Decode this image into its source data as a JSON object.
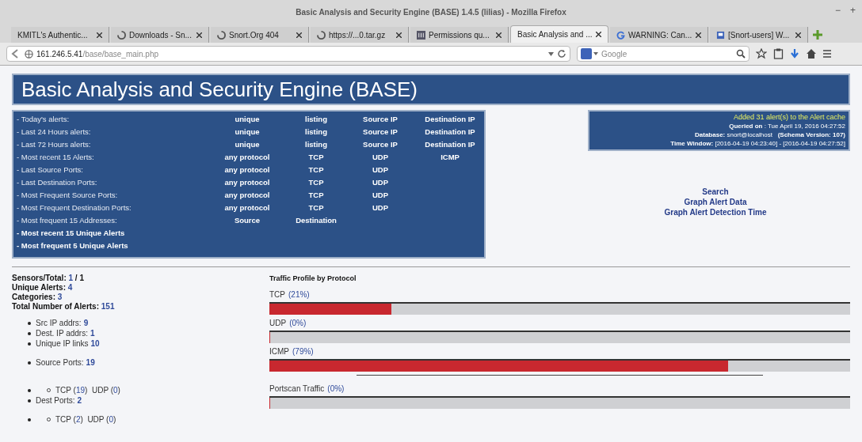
{
  "window": {
    "title": "Basic Analysis and Security Engine (BASE) 1.4.5 (lilias) - Mozilla Firefox",
    "controls": [
      "−",
      "+"
    ]
  },
  "tabs": [
    {
      "label": "KMITL's Authentic...",
      "kind": "plain",
      "selected": false
    },
    {
      "label": "Downloads - Sn...",
      "kind": "spinner",
      "selected": false
    },
    {
      "label": "Snort.Org 404",
      "kind": "spinner",
      "selected": false
    },
    {
      "label": "https://...0.tar.gz",
      "kind": "spinner",
      "selected": false
    },
    {
      "label": "Permissions qu...",
      "kind": "site",
      "selected": false
    },
    {
      "label": "Basic Analysis and ...",
      "kind": "plain",
      "selected": true
    },
    {
      "label": "WARNING: Can...",
      "kind": "google",
      "selected": false
    },
    {
      "label": "[Snort-users] W...",
      "kind": "page",
      "selected": false
    }
  ],
  "address_bar": {
    "host": "161.246.5.41",
    "path": "/base/base_main.php"
  },
  "search": {
    "placeholder": "Google"
  },
  "page": {
    "banner": "Basic Analysis and Security Engine (BASE)",
    "nav_rows": [
      {
        "label": "- Today's alerts:",
        "kind": "normal",
        "links": [
          "unique",
          "listing",
          "Source IP",
          "Destination IP"
        ]
      },
      {
        "label": "- Last 24 Hours alerts:",
        "kind": "normal",
        "links": [
          "unique",
          "listing",
          "Source IP",
          "Destination IP"
        ]
      },
      {
        "label": "- Last 72 Hours alerts:",
        "kind": "normal",
        "links": [
          "unique",
          "listing",
          "Source IP",
          "Destination IP"
        ]
      },
      {
        "label": "- Most recent 15 Alerts:",
        "kind": "normal",
        "links": [
          "any protocol",
          "TCP",
          "UDP",
          "ICMP"
        ]
      },
      {
        "label": "- Last Source Ports:",
        "kind": "normal",
        "links": [
          "any protocol",
          "TCP",
          "UDP"
        ]
      },
      {
        "label": "- Last Destination Ports:",
        "kind": "normal",
        "links": [
          "any protocol",
          "TCP",
          "UDP"
        ]
      },
      {
        "label": "- Most Frequent Source Ports:",
        "kind": "normal",
        "links": [
          "any protocol",
          "TCP",
          "UDP"
        ]
      },
      {
        "label": "- Most Frequent Destination Ports:",
        "kind": "normal",
        "links": [
          "any protocol",
          "TCP",
          "UDP"
        ]
      },
      {
        "label": "- Most frequent 15 Addresses:",
        "kind": "normal",
        "links": [
          "Source",
          "Destination"
        ]
      },
      {
        "label": "- Most recent 15 Unique Alerts",
        "kind": "link",
        "links": []
      },
      {
        "label": "- Most frequent 5 Unique Alerts",
        "kind": "link",
        "links": []
      }
    ],
    "info": {
      "notice": "Added 31 alert(s) to the Alert cache",
      "lines": [
        "**Queried on** : Tue April 19, 2016 04:27:52",
        "**Database:** snort@localhost   **(Schema Version: 107)**",
        "**Time Window:** [2016-04-19 04:23:40] - [2016-04-19 04:27:52]"
      ]
    },
    "actions": [
      "Search",
      "Graph Alert Data",
      "Graph Alert Detection Time"
    ],
    "stats": [
      {
        "label": "Sensors/Total:",
        "value": "1",
        "suffix": " / 1"
      },
      {
        "label": "Unique Alerts:",
        "value": "4"
      },
      {
        "label": "Categories:",
        "value": "3"
      },
      {
        "label": "Total Number of Alerts:",
        "value": "151"
      }
    ],
    "details": [
      {
        "kind": "item",
        "label": "Src IP addrs:",
        "value": "9"
      },
      {
        "kind": "item",
        "label": "Dest. IP addrs:",
        "value": "1"
      },
      {
        "kind": "item",
        "label": "Unique IP links",
        "value": "10"
      },
      {
        "kind": "gap"
      },
      {
        "kind": "item",
        "label": "Source Ports:",
        "value": "19"
      },
      {
        "kind": "gap"
      },
      {
        "kind": "gap"
      },
      {
        "kind": "nested",
        "parts": [
          {
            "text": "TCP (",
            "link": false
          },
          {
            "text": "19",
            "link": true
          },
          {
            "text": ")  UDP (",
            "link": false
          },
          {
            "text": "0",
            "link": true
          },
          {
            "text": ")",
            "link": false
          }
        ]
      },
      {
        "kind": "item",
        "label": "Dest Ports:",
        "value": "2"
      },
      {
        "kind": "gap"
      },
      {
        "kind": "nested",
        "parts": [
          {
            "text": "TCP (",
            "link": false
          },
          {
            "text": "2",
            "link": true
          },
          {
            "text": ")  UDP (",
            "link": false
          },
          {
            "text": "0",
            "link": true
          },
          {
            "text": ")",
            "link": false
          }
        ]
      }
    ],
    "traffic": {
      "title": "Traffic Profile by Protocol",
      "bars": [
        {
          "name": "TCP",
          "reading": "(21%)",
          "level": 0.21
        },
        {
          "name": "UDP",
          "reading": "(0%)",
          "level": 0
        },
        {
          "name": "ICMP",
          "reading": "(79%)",
          "level": 0.79
        }
      ],
      "portscan": {
        "name": "Portscan Traffic",
        "reading": "(0%)",
        "level": 0
      }
    }
  }
}
